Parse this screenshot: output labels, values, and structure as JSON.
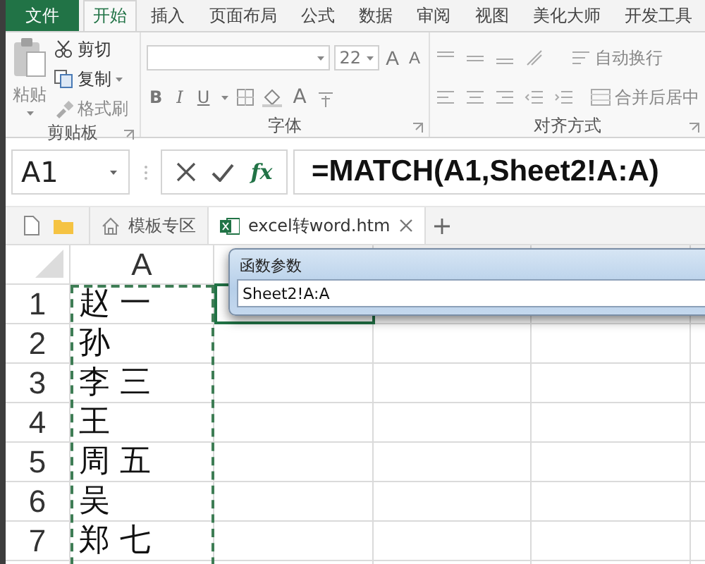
{
  "ribbon_tabs": [
    {
      "label": "文件",
      "kind": "file",
      "selected": false
    },
    {
      "label": "开始",
      "kind": "tab",
      "selected": true
    },
    {
      "label": "插入",
      "kind": "tab",
      "selected": false
    },
    {
      "label": "页面布局",
      "kind": "tab",
      "selected": false
    },
    {
      "label": "公式",
      "kind": "tab",
      "selected": false
    },
    {
      "label": "数据",
      "kind": "tab",
      "selected": false
    },
    {
      "label": "审阅",
      "kind": "tab",
      "selected": false
    },
    {
      "label": "视图",
      "kind": "tab",
      "selected": false
    },
    {
      "label": "美化大师",
      "kind": "tab",
      "selected": false
    },
    {
      "label": "开发工具",
      "kind": "tab",
      "selected": false
    }
  ],
  "clipboard": {
    "paste": "粘贴",
    "cut": "剪切",
    "copy": "复制",
    "format_painter": "格式刷",
    "group_label": "剪贴板"
  },
  "font": {
    "size": "22",
    "grow": "A",
    "shrink": "A",
    "bold": "B",
    "italic": "I",
    "underline": "U",
    "font_color": "A",
    "group_label": "字体"
  },
  "alignment": {
    "wrap_text": "自动换行",
    "merge_center": "合并后居中",
    "group_label": "对齐方式"
  },
  "formula_bar": {
    "name_box": "A1",
    "fx": "fx",
    "formula": "=MATCH(A1,Sheet2!A:A)"
  },
  "doc_tabs": [
    {
      "label": "模板专区",
      "kind": "home",
      "selected": false
    },
    {
      "label": "excel转word.htm",
      "kind": "excel",
      "selected": true
    }
  ],
  "sheet": {
    "column_header": "A",
    "rows": [
      {
        "number": "1",
        "value": "赵 一"
      },
      {
        "number": "2",
        "value": "孙"
      },
      {
        "number": "3",
        "value": "李 三"
      },
      {
        "number": "4",
        "value": "王"
      },
      {
        "number": "5",
        "value": "周 五"
      },
      {
        "number": "6",
        "value": "吴"
      },
      {
        "number": "7",
        "value": "郑 七"
      }
    ]
  },
  "dialog": {
    "title": "函数参数",
    "value": "Sheet2!A:A"
  }
}
